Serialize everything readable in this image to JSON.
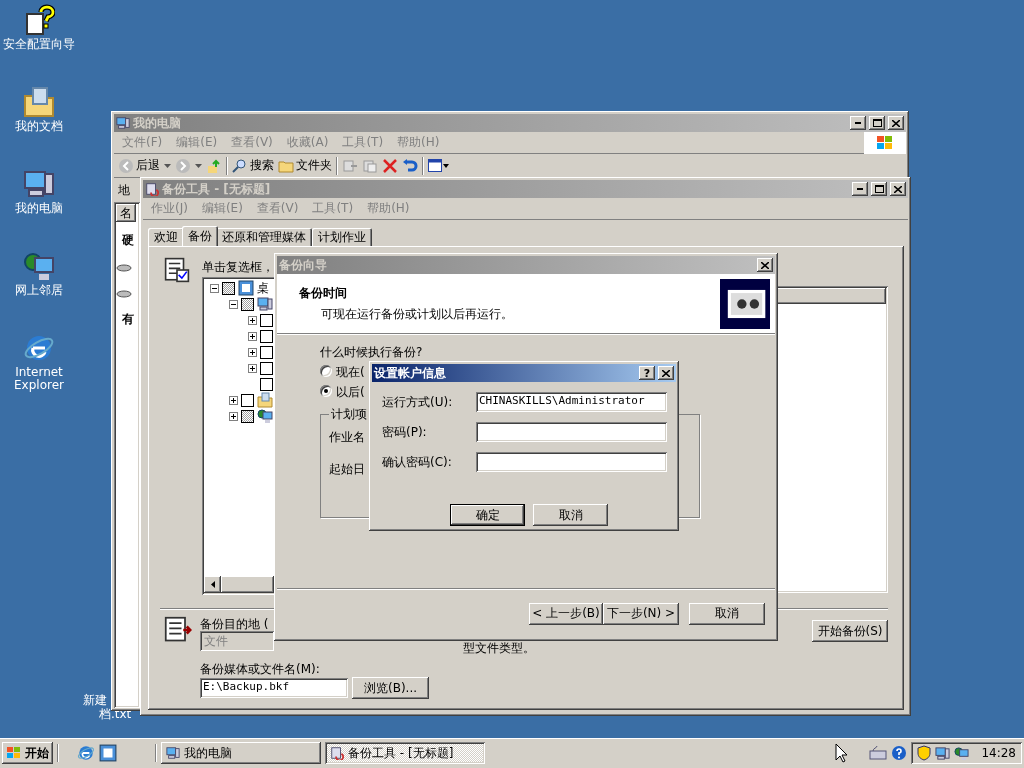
{
  "desktop_icons": [
    {
      "label": "安全配置向导",
      "kind": "wizard"
    },
    {
      "label": "我的文档",
      "kind": "documents"
    },
    {
      "label": "我的电脑",
      "kind": "computer"
    },
    {
      "label": "网上邻居",
      "kind": "network"
    },
    {
      "label": "Internet Explorer",
      "kind": "ie"
    }
  ],
  "desktop_file": {
    "lines": [
      "新建",
      "档.txt"
    ]
  },
  "explorer": {
    "title": "我的电脑",
    "active": false,
    "menu": [
      "文件(F)",
      "编辑(E)",
      "查看(V)",
      "收藏(A)",
      "工具(T)",
      "帮助(H)"
    ],
    "back": "后退",
    "search": "搜索",
    "folders": "文件夹",
    "address": "地",
    "header": "名",
    "items": [
      "硬",
      "有"
    ]
  },
  "backup": {
    "title": "备份工具 - [无标题]",
    "active": false,
    "menu": [
      "作业(J)",
      "编辑(E)",
      "查看(V)",
      "工具(T)",
      "帮助(H)"
    ],
    "tabs": [
      {
        "label": "欢迎",
        "selected": false
      },
      {
        "label": "备份",
        "selected": true
      },
      {
        "label": "还原和管理媒体",
        "selected": false
      },
      {
        "label": "计划作业",
        "selected": false
      }
    ],
    "instruction": "单击复选框，",
    "tree": [
      {
        "label": "桌",
        "kind": "desktop",
        "expanded": true,
        "checked": false,
        "partial": true,
        "children": [
          {
            "kind": "computer",
            "expanded": true,
            "checked": false,
            "partial": true,
            "children": [
              {
                "kind": "folder",
                "expanded": false,
                "checked": false,
                "partial": false
              },
              {
                "kind": "folder",
                "expanded": false,
                "checked": false,
                "partial": false
              },
              {
                "kind": "folder",
                "expanded": false,
                "checked": false,
                "partial": false
              },
              {
                "kind": "folder",
                "expanded": false,
                "checked": false,
                "partial": false
              },
              {
                "kind": "leaf",
                "checked": false,
                "partial": false
              }
            ]
          },
          {
            "kind": "documents",
            "expanded": false,
            "checked": false,
            "partial": false
          },
          {
            "kind": "network",
            "expanded": false,
            "checked": false,
            "partial": true
          }
        ]
      }
    ],
    "destination_label": "备份目的地 (",
    "destination": {
      "value": "文件",
      "disabled": true
    },
    "media_label": "备份媒体或文件名(M):",
    "media_value": "E:\\Backup.bkf",
    "browse": "浏览(B)...",
    "note": "型文件类型。",
    "start": "开始备份(S)"
  },
  "wizard": {
    "title": "备份向导",
    "active": false,
    "heading": "备份时间",
    "subheading": "可现在运行备份或计划以后再运行。",
    "question": "什么时候执行备份?",
    "radios": [
      {
        "label": "现在(",
        "selected": false
      },
      {
        "label": "以后(",
        "selected": true
      }
    ],
    "group": "计划项",
    "group_rows": [
      "作业名",
      "起始日"
    ],
    "buttons": [
      "< 上一步(B)",
      "下一步(N) >",
      "取消"
    ]
  },
  "account_dialog": {
    "title": "设置帐户信息",
    "active": true,
    "help": "?",
    "fields": [
      {
        "label": "运行方式(U):",
        "value": "CHINASKILLS\\Administrator"
      },
      {
        "label": "密码(P):"
      },
      {
        "label": "确认密码(C):"
      }
    ],
    "buttons": [
      {
        "label": "确定",
        "default": true
      },
      {
        "label": "取消",
        "default": false
      }
    ]
  },
  "taskbar": {
    "start": "开始",
    "tasks": [
      {
        "label": "我的电脑",
        "selected": false
      },
      {
        "label": "备份工具 - [无标题]",
        "selected": true
      }
    ],
    "clock": "14:28"
  }
}
